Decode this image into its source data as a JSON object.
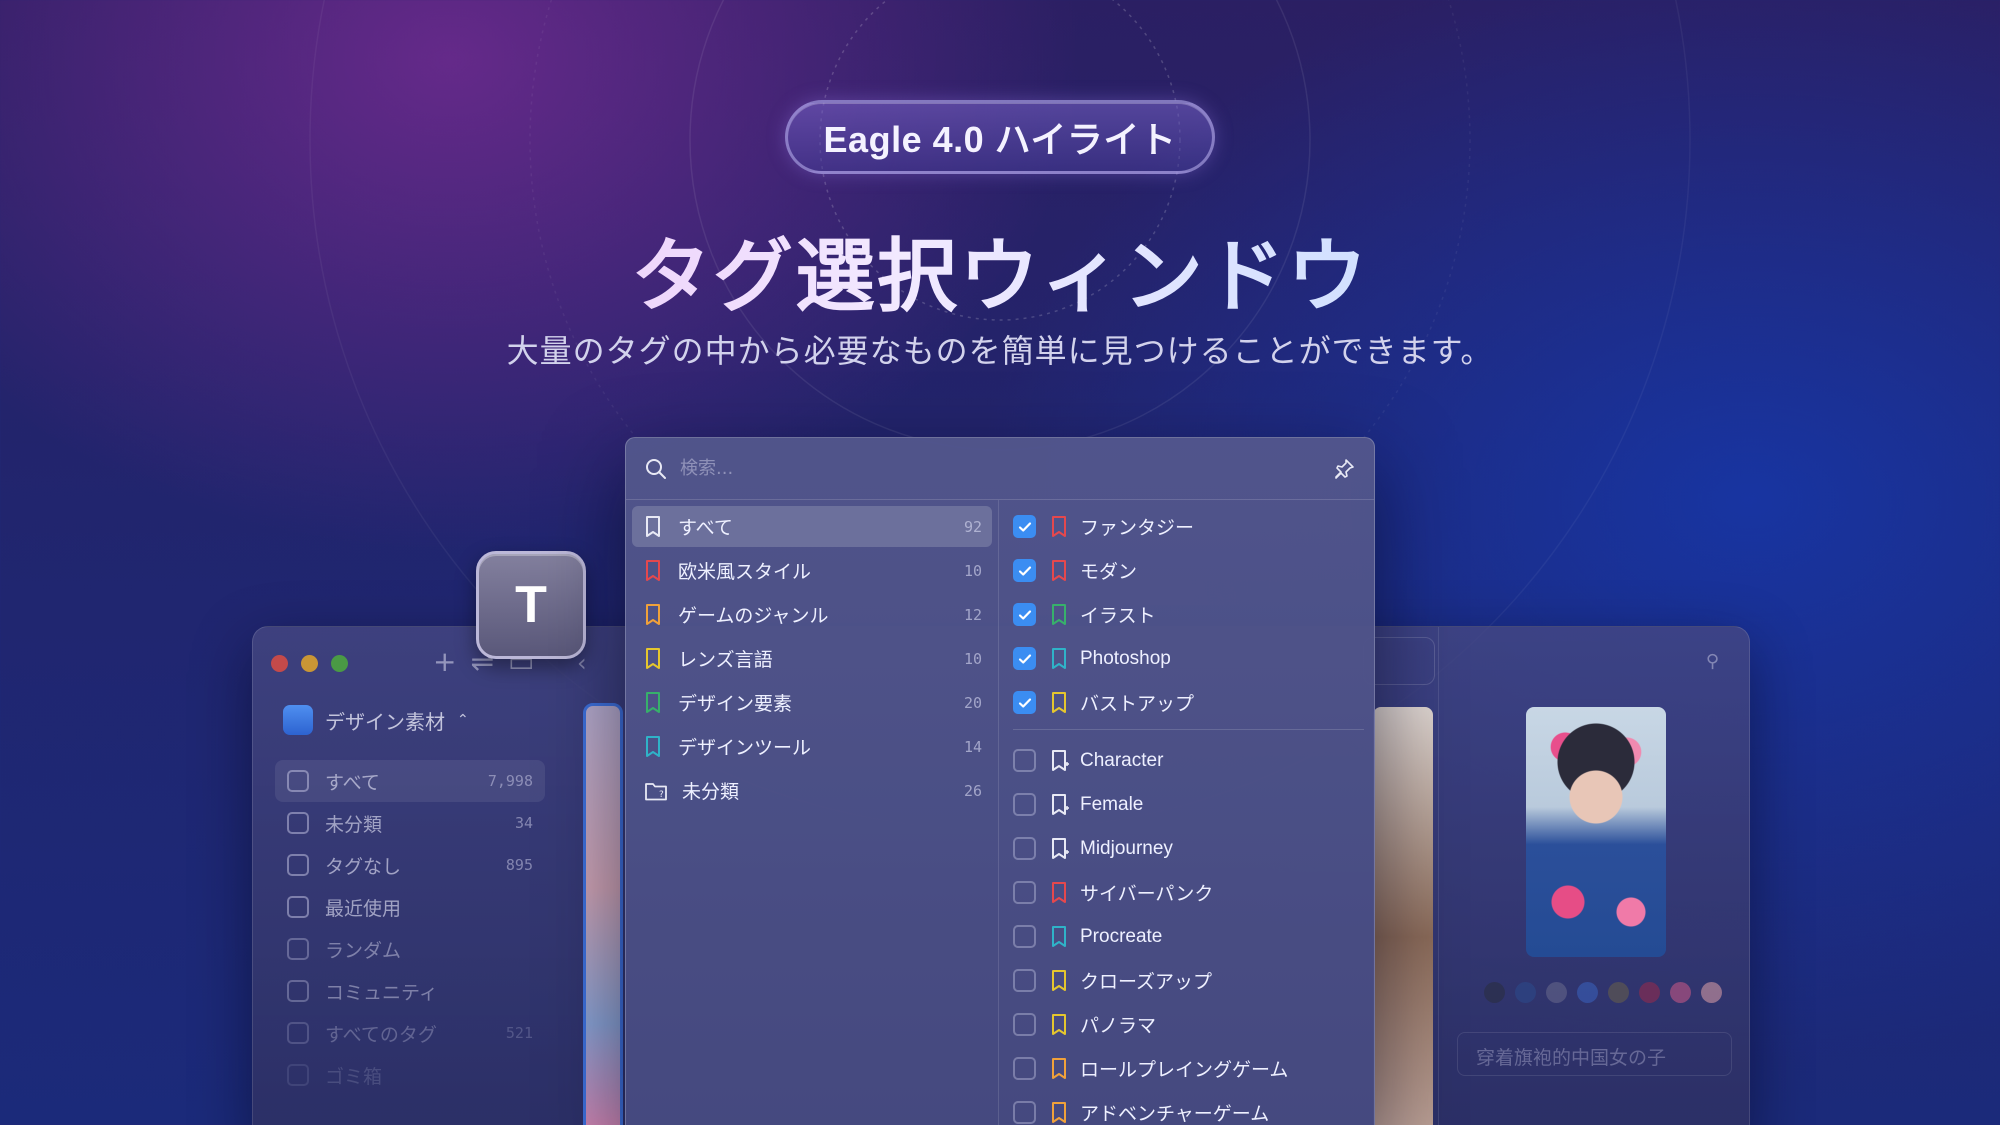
{
  "hero": {
    "badge": "Eagle 4.0 ハイライト",
    "title": "タグ選択ウィンドウ",
    "subtitle": "大量のタグの中から必要なものを簡単に見つけることができます。"
  },
  "shortcut_key": "T",
  "colors": {
    "checkbox_on": "#3b8df2",
    "tag_red": "#e5484d",
    "tag_orange": "#f0a13a",
    "tag_yellow": "#e5c62e",
    "tag_green": "#37b06b",
    "tag_teal": "#2fb3c8",
    "tag_white": "#e8e9f5"
  },
  "background_app": {
    "library_name": "デザイン素材",
    "sidebar": [
      {
        "label": "すべて",
        "count": "7,998",
        "icon": "inbox-icon"
      },
      {
        "label": "未分類",
        "count": "34",
        "icon": "folder-question-icon"
      },
      {
        "label": "タグなし",
        "count": "895",
        "icon": "tag-question-icon"
      },
      {
        "label": "最近使用",
        "count": "",
        "icon": "clock-icon"
      },
      {
        "label": "ランダム",
        "count": "",
        "icon": "shuffle-icon"
      },
      {
        "label": "コミュニティ",
        "count": "",
        "icon": "download-box-icon"
      },
      {
        "label": "すべてのタグ",
        "count": "521",
        "icon": "tag-icon"
      },
      {
        "label": "ゴミ箱",
        "count": "",
        "icon": "trash-icon"
      }
    ],
    "image_caption": "穿着旗袍的中国女の子"
  },
  "tag_picker": {
    "search_placeholder": "検索...",
    "categories": [
      {
        "label": "すべて",
        "count": "92",
        "color": "tag_white",
        "active": true
      },
      {
        "label": "欧米風スタイル",
        "count": "10",
        "color": "tag_red"
      },
      {
        "label": "ゲームのジャンル",
        "count": "12",
        "color": "tag_orange"
      },
      {
        "label": "レンズ言語",
        "count": "10",
        "color": "tag_yellow"
      },
      {
        "label": "デザイン要素",
        "count": "20",
        "color": "tag_green"
      },
      {
        "label": "デザインツール",
        "count": "14",
        "color": "tag_teal"
      },
      {
        "label": "未分類",
        "count": "26",
        "color": "folder"
      }
    ],
    "selected_tags": [
      {
        "label": "ファンタジー",
        "color": "tag_red",
        "checked": true
      },
      {
        "label": "モダン",
        "color": "tag_red",
        "checked": true
      },
      {
        "label": "イラスト",
        "color": "tag_green",
        "checked": true
      },
      {
        "label": "Photoshop",
        "color": "tag_teal",
        "checked": true
      },
      {
        "label": "バストアップ",
        "color": "tag_yellow",
        "checked": true
      }
    ],
    "other_tags": [
      {
        "label": "Character",
        "color": "tag_white",
        "checked": false
      },
      {
        "label": "Female",
        "color": "tag_white",
        "checked": false
      },
      {
        "label": "Midjourney",
        "color": "tag_white",
        "checked": false
      },
      {
        "label": "サイバーパンク",
        "color": "tag_red",
        "checked": false
      },
      {
        "label": "Procreate",
        "color": "tag_teal",
        "checked": false
      },
      {
        "label": "クローズアップ",
        "color": "tag_yellow",
        "checked": false
      },
      {
        "label": "パノラマ",
        "color": "tag_yellow",
        "checked": false
      },
      {
        "label": "ロールプレイングゲーム",
        "color": "tag_orange",
        "checked": false
      },
      {
        "label": "アドベンチャーゲーム",
        "color": "tag_orange",
        "checked": false
      }
    ]
  }
}
